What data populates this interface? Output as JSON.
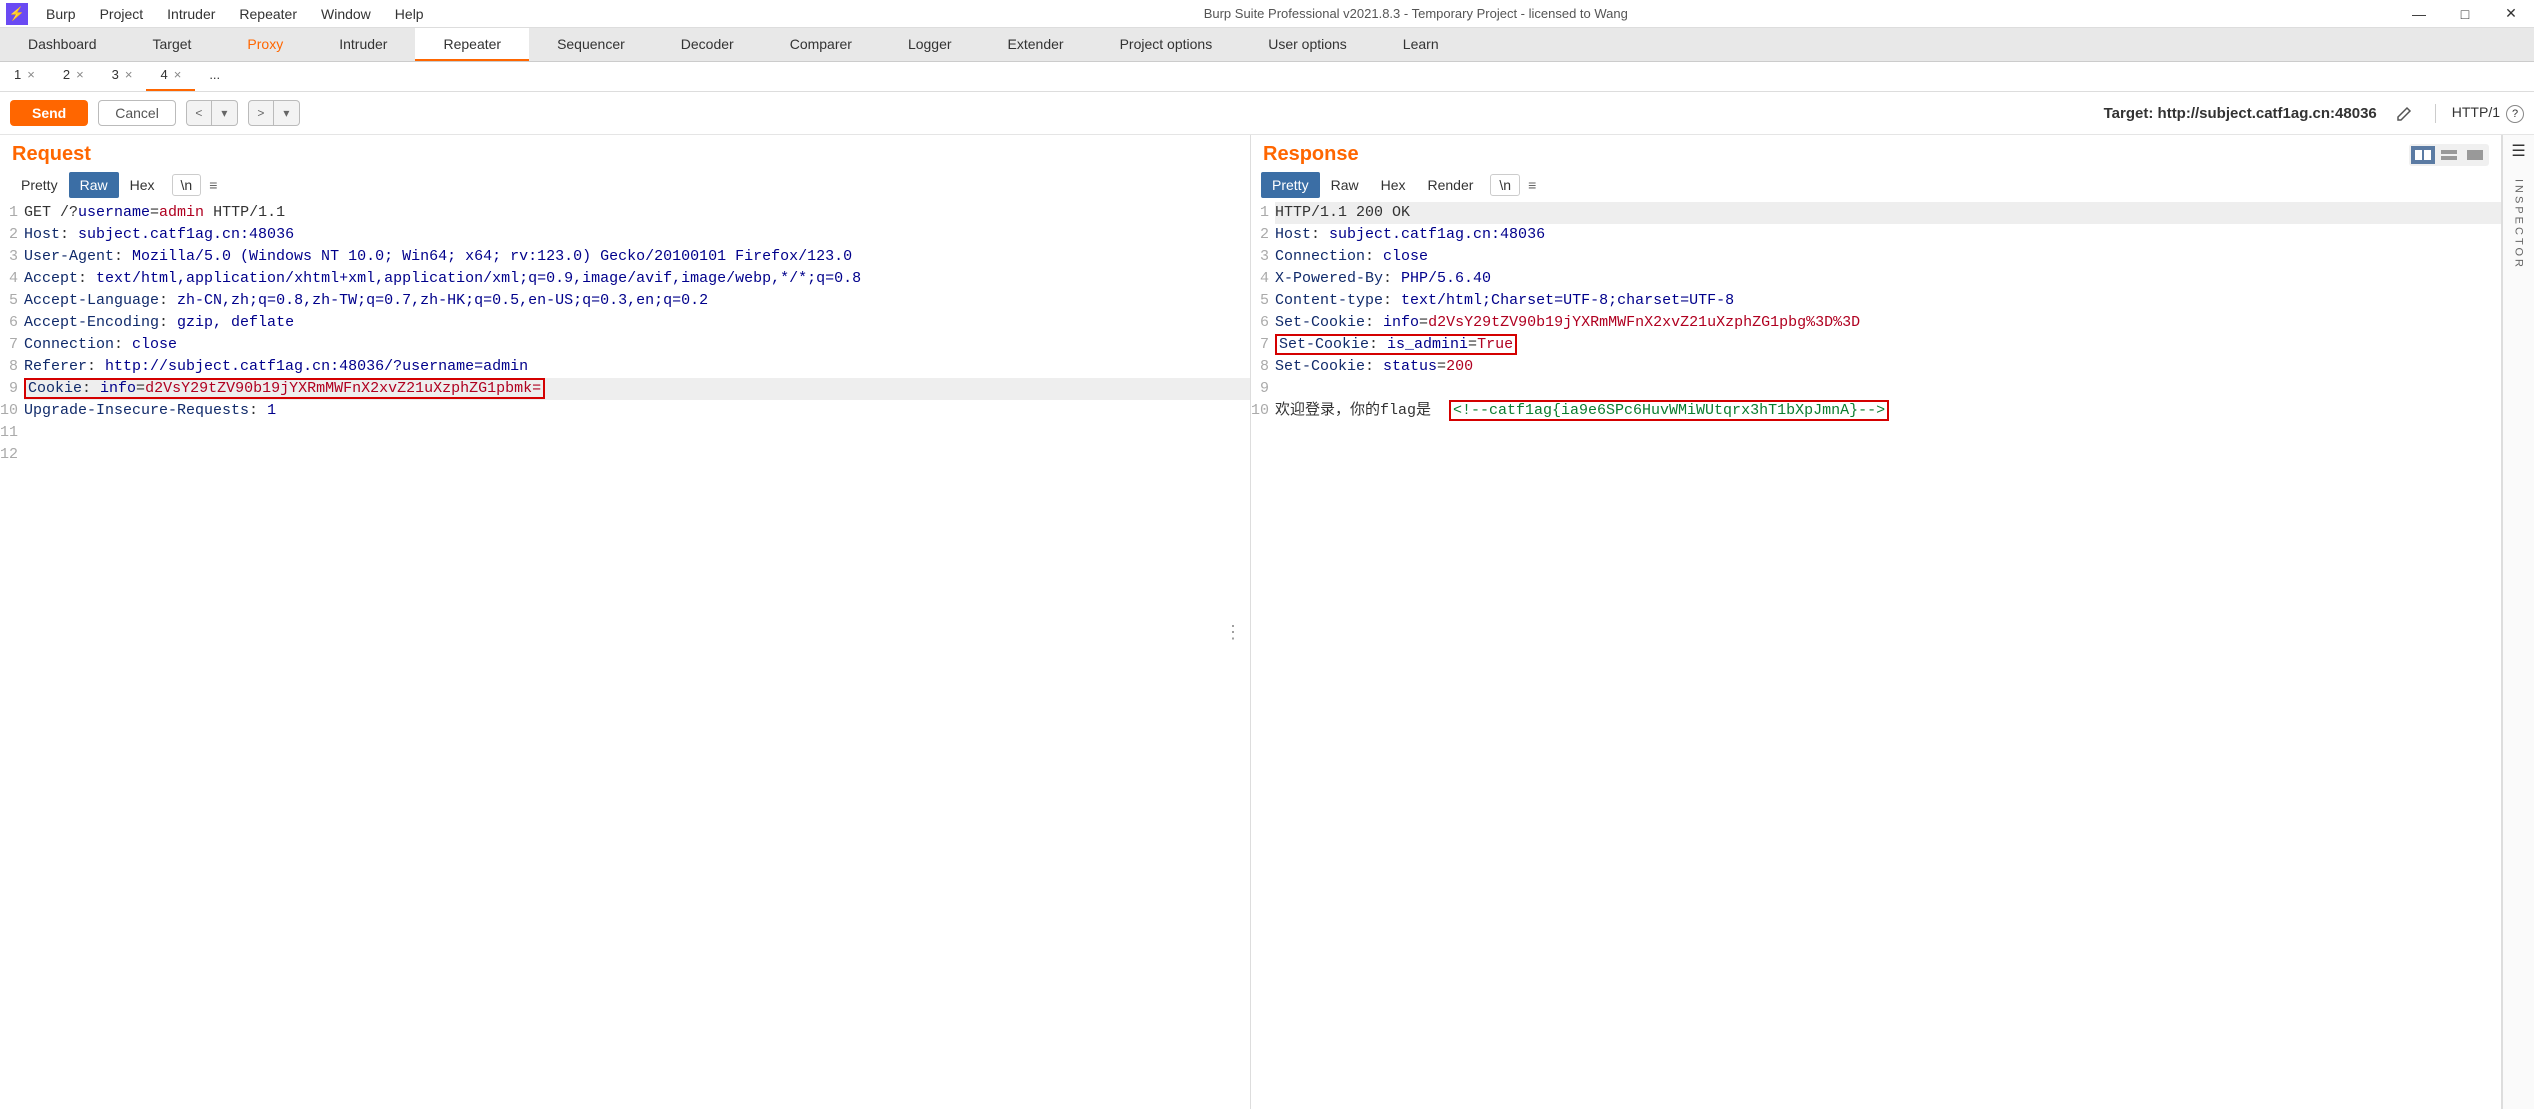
{
  "window": {
    "title": "Burp Suite Professional v2021.8.3 - Temporary Project - licensed to Wang",
    "menu": [
      "Burp",
      "Project",
      "Intruder",
      "Repeater",
      "Window",
      "Help"
    ]
  },
  "main_tabs": [
    "Dashboard",
    "Target",
    "Proxy",
    "Intruder",
    "Repeater",
    "Sequencer",
    "Decoder",
    "Comparer",
    "Logger",
    "Extender",
    "Project options",
    "User options",
    "Learn"
  ],
  "active_main_tab": "Repeater",
  "sub_tabs": [
    {
      "label": "1",
      "close": "×"
    },
    {
      "label": "2",
      "close": "×"
    },
    {
      "label": "3",
      "close": "×"
    },
    {
      "label": "4",
      "close": "×"
    },
    {
      "label": "...",
      "close": ""
    }
  ],
  "active_sub_tab": 3,
  "toolbar": {
    "send": "Send",
    "cancel": "Cancel",
    "target_label": "Target: ",
    "target_value": "http://subject.catf1ag.cn:48036",
    "http_version": "HTTP/1"
  },
  "request": {
    "title": "Request",
    "views": [
      "Pretty",
      "Raw",
      "Hex",
      "\\n"
    ],
    "active_view": "Raw",
    "lines": [
      {
        "n": 1,
        "pre": "GET /?",
        "param": "username",
        "eq": "=",
        "val": "admin",
        "post": " HTTP/1.1"
      },
      {
        "n": 2,
        "h": "Host",
        "v": "subject.catf1ag.cn:48036"
      },
      {
        "n": 3,
        "h": "User-Agent",
        "v": "Mozilla/5.0 (Windows NT 10.0; Win64; x64; rv:123.0) Gecko/20100101 Firefox/123.0"
      },
      {
        "n": 4,
        "h": "Accept",
        "v": "text/html,application/xhtml+xml,application/xml;q=0.9,image/avif,image/webp,*/*;q=0.8"
      },
      {
        "n": 5,
        "h": "Accept-Language",
        "v": "zh-CN,zh;q=0.8,zh-TW;q=0.7,zh-HK;q=0.5,en-US;q=0.3,en;q=0.2"
      },
      {
        "n": 6,
        "h": "Accept-Encoding",
        "v": "gzip, deflate"
      },
      {
        "n": 7,
        "h": "Connection",
        "v": "close"
      },
      {
        "n": 8,
        "h": "Referer",
        "v": "http://subject.catf1ag.cn:48036/?username=admin"
      },
      {
        "n": 9,
        "h": "Cookie",
        "param": "info",
        "val": "d2VsY29tZV90b19jYXRmMWFnX2xvZ21uXzphZG1pbmk=",
        "boxed": true,
        "hi": true
      },
      {
        "n": 10,
        "h": "Upgrade-Insecure-Requests",
        "v": "1"
      },
      {
        "n": 11,
        "blank": true
      },
      {
        "n": 12,
        "blank": true
      }
    ]
  },
  "response": {
    "title": "Response",
    "views": [
      "Pretty",
      "Raw",
      "Hex",
      "Render",
      "\\n"
    ],
    "active_view": "Pretty",
    "lines": [
      {
        "n": 1,
        "plain": "HTTP/1.1 200 OK",
        "hi": true
      },
      {
        "n": 2,
        "h": "Host",
        "v": "subject.catf1ag.cn:48036"
      },
      {
        "n": 3,
        "h": "Connection",
        "v": "close"
      },
      {
        "n": 4,
        "h": "X-Powered-By",
        "v": "PHP/5.6.40"
      },
      {
        "n": 5,
        "h": "Content-type",
        "v": "text/html;Charset=UTF-8;charset=UTF-8"
      },
      {
        "n": 6,
        "h": "Set-Cookie",
        "param": "info",
        "val": "d2VsY29tZV90b19jYXRmMWFnX2xvZ21uXzphZG1pbg%3D%3D"
      },
      {
        "n": 7,
        "h": "Set-Cookie",
        "param": "is_admini",
        "val": "True",
        "boxed": true
      },
      {
        "n": 8,
        "h": "Set-Cookie",
        "param": "status",
        "val": "200"
      },
      {
        "n": 9,
        "blank": true
      },
      {
        "n": 10,
        "body_pre": "欢迎登录，你的flag是  ",
        "body_green": "<!--catf1ag{ia9e6SPc6HuvWMiWUtqrx3hT1bXpJmnA}-->",
        "boxed_green": true
      }
    ]
  },
  "inspector_label": "INSPECTOR"
}
